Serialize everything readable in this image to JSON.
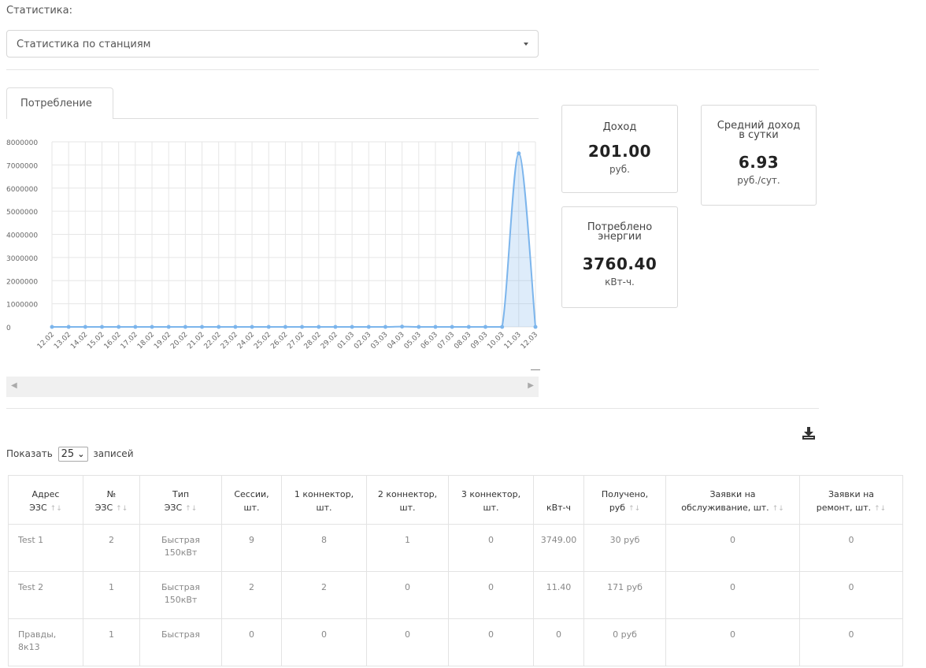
{
  "filter": {
    "label": "Статистика:",
    "selected": "Статистика по станциям"
  },
  "tabs": [
    {
      "label": "Потребление"
    }
  ],
  "chart_data": {
    "type": "area",
    "x": [
      "12.02",
      "13.02",
      "14.02",
      "15.02",
      "16.02",
      "17.02",
      "18.02",
      "19.02",
      "20.02",
      "21.02",
      "22.02",
      "23.02",
      "24.02",
      "25.02",
      "26.02",
      "27.02",
      "28.02",
      "29.02",
      "01.03",
      "02.03",
      "03.03",
      "04.03",
      "05.03",
      "06.03",
      "07.03",
      "08.03",
      "09.03",
      "10.03",
      "11.03",
      "12.03"
    ],
    "series": [
      {
        "values": [
          0,
          0,
          0,
          0,
          0,
          0,
          0,
          0,
          0,
          0,
          0,
          0,
          0,
          0,
          0,
          0,
          0,
          0,
          0,
          0,
          0,
          11400,
          0,
          0,
          0,
          0,
          0,
          0,
          7500000,
          0
        ]
      }
    ],
    "ylim": [
      0,
      8000000
    ],
    "yticks": [
      "0",
      "1000000",
      "2000000",
      "3000000",
      "4000000",
      "5000000",
      "6000000",
      "7000000",
      "8000000"
    ],
    "grid": true,
    "color": "#7cb5ec"
  },
  "cards": {
    "income": {
      "title": "Доход",
      "value": "201.00",
      "unit": "руб."
    },
    "avg_income": {
      "title_line1": "Средний доход",
      "title_line2": "в сутки",
      "value": "6.93",
      "unit": "руб./сут."
    },
    "energy": {
      "title_line1": "Потреблено",
      "title_line2": "энергии",
      "value": "3760.40",
      "unit": "кВт-ч."
    }
  },
  "table_controls": {
    "show_label": "Показать",
    "page_size": "25",
    "records_label": "записей"
  },
  "table": {
    "headers": [
      [
        "Адрес",
        "ЭЗС"
      ],
      [
        "№",
        "ЭЗС"
      ],
      [
        "Тип",
        "ЭЗС"
      ],
      [
        "Сессии,",
        "шт."
      ],
      [
        "1 коннектор,",
        "шт."
      ],
      [
        "2 коннектор,",
        "шт."
      ],
      [
        "3 коннектор,",
        "шт."
      ],
      [
        "",
        "кВт-ч"
      ],
      [
        "Получено,",
        "руб"
      ],
      [
        "Заявки на",
        "обслуживание, шт."
      ],
      [
        "Заявки на",
        "ремонт, шт."
      ]
    ],
    "rows": [
      {
        "address": "Test 1",
        "num": "2",
        "type_l1": "Быстрая",
        "type_l2": "150кВт",
        "sessions": "9",
        "c1": "8",
        "c2": "1",
        "c3": "0",
        "kwh": "3749.00",
        "received": "30 руб",
        "service": "0",
        "repair": "0"
      },
      {
        "address": "Test 2",
        "num": "1",
        "type_l1": "Быстрая",
        "type_l2": "150кВт",
        "sessions": "2",
        "c1": "2",
        "c2": "0",
        "c3": "0",
        "kwh": "11.40",
        "received": "171 руб",
        "service": "0",
        "repair": "0"
      },
      {
        "address_l1": "Правды,",
        "address_l2": "8к13",
        "num": "1",
        "type_l1": "Быстрая",
        "sessions": "0",
        "c1": "0",
        "c2": "0",
        "c3": "0",
        "kwh": "0",
        "received": "0 руб",
        "service": "0",
        "repair": "0"
      }
    ]
  }
}
